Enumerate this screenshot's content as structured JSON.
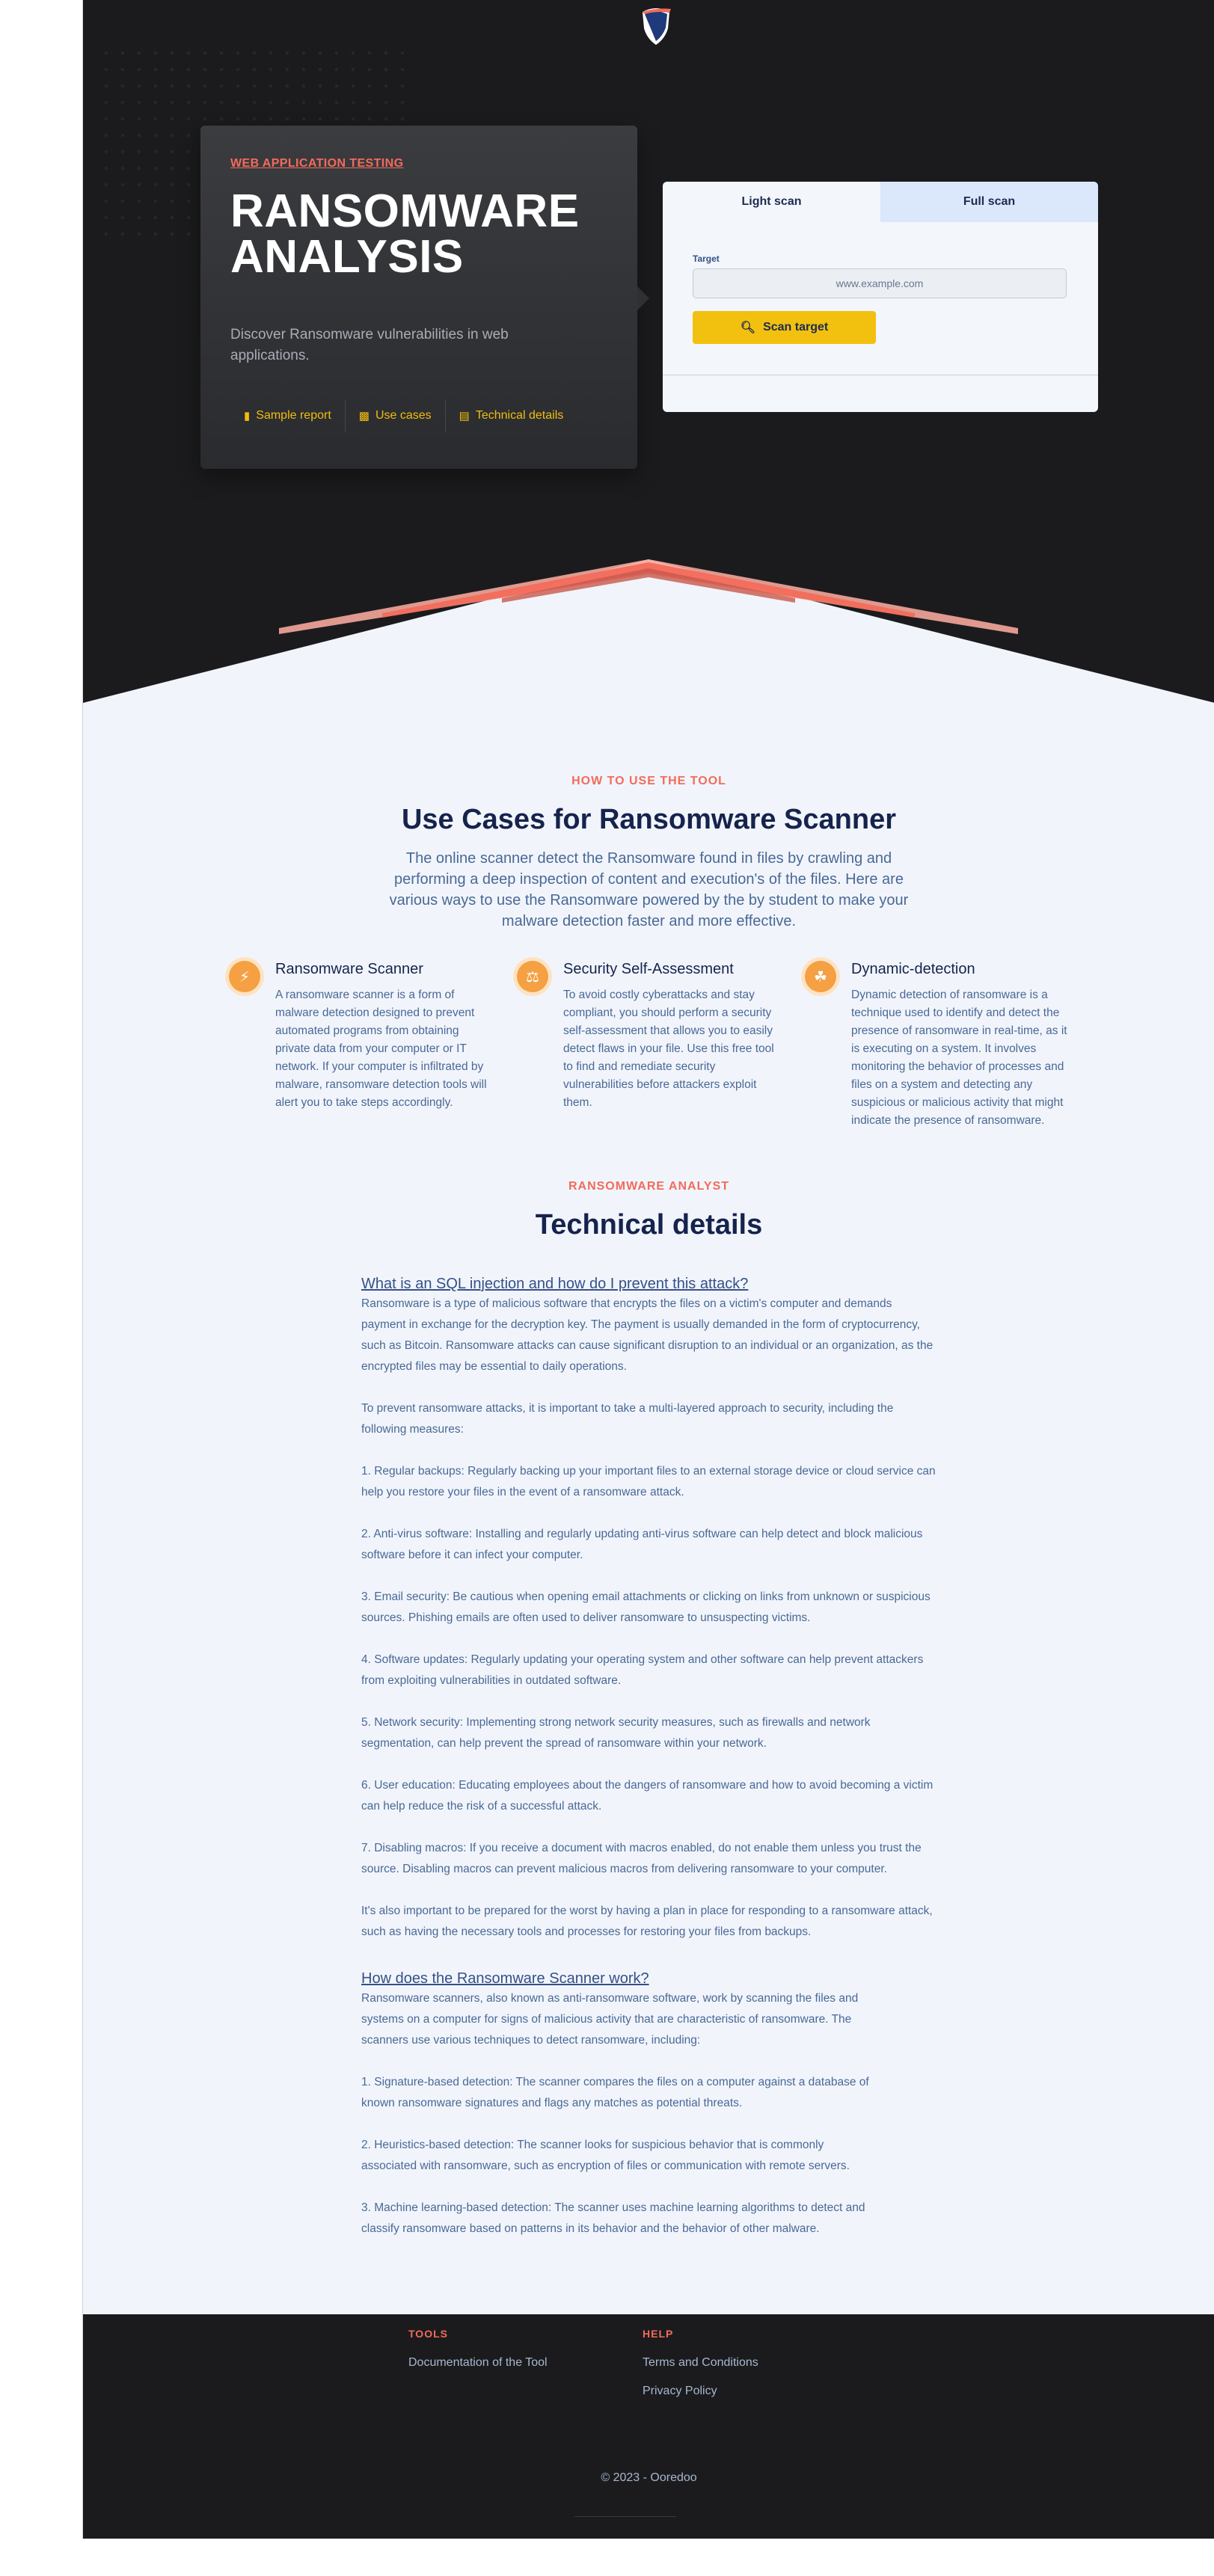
{
  "hero": {
    "eyebrow": "WEB APPLICATION TESTING",
    "title": "RANSOMWARE ANALYSIS",
    "subtitle": "Discover Ransomware vulnerabilities in web applications.",
    "links": [
      {
        "label": "Sample report",
        "icon": "document-icon"
      },
      {
        "label": "Use cases",
        "icon": "user-document-icon"
      },
      {
        "label": "Technical details",
        "icon": "list-icon"
      }
    ]
  },
  "scanner": {
    "tabs": [
      {
        "label": "Light scan",
        "active": true
      },
      {
        "label": "Full scan",
        "active": false
      }
    ],
    "target_label": "Target",
    "target_placeholder": "www.example.com",
    "button_label": "Scan target"
  },
  "use_cases": {
    "eyebrow": "HOW TO USE THE TOOL",
    "title": "Use Cases for Ransomware Scanner",
    "description": "The online scanner detect the Ransomware found in files by crawling and performing a deep inspection of content and execution's of the files. Here are various ways to use the Ransomware powered by the by student to make your malware detection faster and more effective.",
    "features": [
      {
        "title": "Ransomware Scanner",
        "icon": "lightning-icon",
        "text": "A ransomware scanner is a form of malware detection designed to prevent automated programs from obtaining private data from your computer or IT network. If your computer is infiltrated by malware, ransomware detection tools will alert you to take steps accordingly."
      },
      {
        "title": "Security Self-Assessment",
        "icon": "balance-scale-icon",
        "text": "To avoid costly cyberattacks and stay compliant, you should perform a security self-assessment that allows you to easily detect flaws in your file. Use this free tool to find and remediate security vulnerabilities before attackers exploit them."
      },
      {
        "title": "Dynamic-detection",
        "icon": "factory-icon",
        "text": "Dynamic detection of ransomware is a technique used to identify and detect the presence of ransomware in real-time, as it is executing on a system. It involves monitoring the behavior of processes and files on a system and detecting any suspicious or malicious activity that might indicate the presence of ransomware."
      }
    ]
  },
  "technical": {
    "eyebrow": "RANSOMWARE ANALYST",
    "title": "Technical details",
    "article1": {
      "heading": "What is an SQL injection and how do I prevent this attack?",
      "paragraphs": [
        "Ransomware is a type of malicious software that encrypts the files on a victim's computer and demands payment in exchange for the decryption key. The payment is usually demanded in the form of cryptocurrency, such as Bitcoin. Ransomware attacks can cause significant disruption to an individual or an organization, as the encrypted files may be essential to daily operations.",
        "To prevent ransomware attacks, it is important to take a multi-layered approach to security, including the following measures:",
        "1. Regular backups: Regularly backing up your important files to an external storage device or cloud service can help you restore your files in the event of a ransomware attack.",
        "2. Anti-virus software: Installing and regularly updating anti-virus software can help detect and block malicious software before it can infect your computer.",
        "3. Email security: Be cautious when opening email attachments or clicking on links from unknown or suspicious sources. Phishing emails are often used to deliver ransomware to unsuspecting victims.",
        "4. Software updates: Regularly updating your operating system and other software can help prevent attackers from exploiting vulnerabilities in outdated software.",
        "5. Network security: Implementing strong network security measures, such as firewalls and network segmentation, can help prevent the spread of ransomware within your network.",
        "6. User education: Educating employees about the dangers of ransomware and how to avoid becoming a victim can help reduce the risk of a successful attack.",
        "7. Disabling macros: If you receive a document with macros enabled, do not enable them unless you trust the source. Disabling macros can prevent malicious macros from delivering ransomware to your computer.",
        "It's also important to be prepared for the worst by having a plan in place for responding to a ransomware attack, such as having the necessary tools and processes for restoring your files from backups."
      ]
    },
    "article2": {
      "heading": "How does the Ransomware  Scanner work?",
      "paragraphs": [
        "Ransomware scanners, also known as anti-ransomware software, work by scanning the files and systems on a computer for signs of malicious activity that are characteristic of ransomware. The scanners use various techniques to detect ransomware, including:",
        "1. Signature-based detection: The scanner compares the files on a computer against a database of known ransomware signatures and flags any matches as potential threats.",
        "2. Heuristics-based detection: The scanner looks for suspicious behavior that is commonly associated with ransomware, such as encryption of files or communication with remote servers.",
        "3. Machine learning-based detection: The scanner uses machine learning algorithms to detect and classify ransomware based on patterns in its behavior and the behavior of other malware."
      ]
    }
  },
  "footer": {
    "tools_heading": "TOOLS",
    "tools_links": [
      "Documentation of the Tool"
    ],
    "help_heading": "HELP",
    "help_links": [
      "Terms and Conditions",
      "Privacy Policy"
    ],
    "copyright": "© 2023 - Ooredoo"
  },
  "colors": {
    "accent_coral": "#f26b5b",
    "accent_yellow": "#f2c00f",
    "navy": "#16234d",
    "hero_bg": "#1b1b1d"
  }
}
